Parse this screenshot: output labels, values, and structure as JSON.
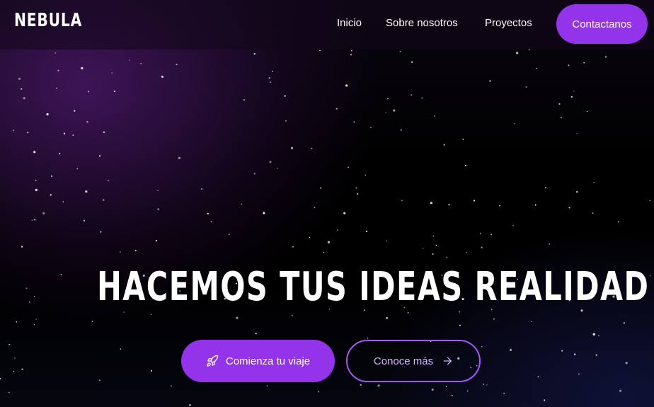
{
  "brand": {
    "logo_text": "NEBULA"
  },
  "nav": {
    "links": [
      {
        "label": "Inicio"
      },
      {
        "label": "Sobre nosotros"
      },
      {
        "label": "Proyectos"
      }
    ],
    "cta_label": "Contactanos"
  },
  "hero": {
    "title": "HACEMOS TUS IDEAS REALIDAD",
    "primary_button": {
      "label": "Comienza tu viaje",
      "icon": "rocket-icon"
    },
    "secondary_button": {
      "label": "Conoce más",
      "icon": "arrow-right-icon"
    }
  },
  "colors": {
    "accent": "#9333ea",
    "accent_outline": "#a855f7",
    "accent_text": "#d8b4fe",
    "background": "#000000"
  }
}
